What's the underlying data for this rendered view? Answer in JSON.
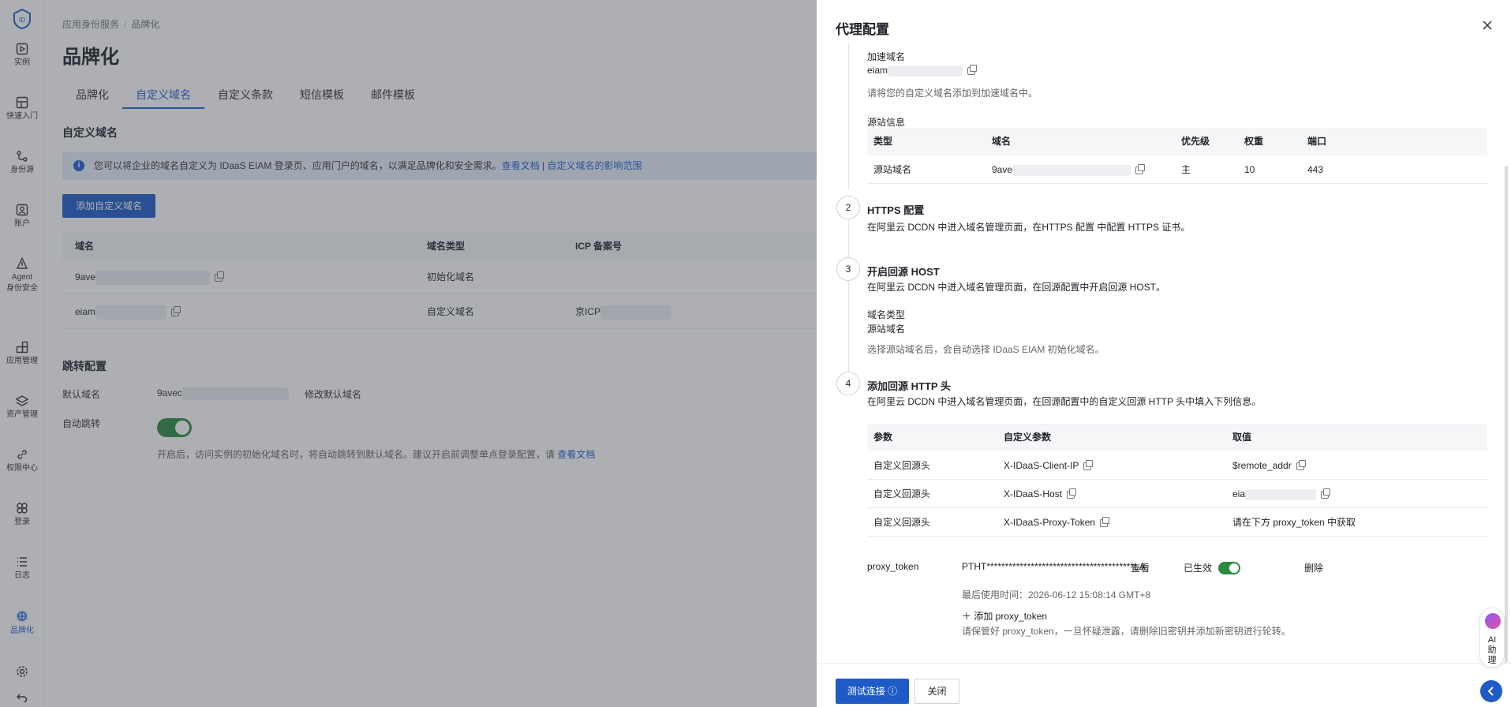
{
  "sidebar": {
    "items": [
      {
        "label": "实例"
      },
      {
        "label": "快速入门"
      },
      {
        "label": "身份源"
      },
      {
        "label": "账户"
      },
      {
        "label": "Agent"
      },
      {
        "label": "身份安全"
      },
      {
        "label": "应用管理"
      },
      {
        "label": "资产管理"
      },
      {
        "label": "权限中心"
      },
      {
        "label": "登录"
      },
      {
        "label": "日志"
      },
      {
        "label": "品牌化"
      }
    ]
  },
  "breadcrumb": {
    "parent": "应用身份服务",
    "sep": "/",
    "current": "品牌化"
  },
  "page_title": "品牌化",
  "tabs": [
    "品牌化",
    "自定义域名",
    "自定义条款",
    "短信模板",
    "邮件模板"
  ],
  "custom_domain": {
    "section_title": "自定义域名",
    "notice_text": "您可以将企业的域名自定义为 IDaaS EIAM 登录页、应用门户的域名，以满足品牌化和安全需求。",
    "notice_link1": "查看文档",
    "notice_sep": " | ",
    "notice_link2": "自定义域名的影响范围",
    "add_button": "添加自定义域名",
    "columns": [
      "域名",
      "域名类型",
      "ICP 备案号"
    ],
    "rows": [
      {
        "domain": "9ave",
        "type": "初始化域名",
        "icp": ""
      },
      {
        "domain": "eiam",
        "type": "自定义域名",
        "icp": "京ICP"
      }
    ]
  },
  "redirect": {
    "section_title": "跳转配置",
    "default_label": "默认域名",
    "default_value": "9avec",
    "modify_link": "修改默认域名",
    "auto_label": "自动跳转",
    "auto_on": true,
    "hint": "开启后，访问实例的初始化域名时，将自动跳转到默认域名。建议开启前调整单点登录配置，请",
    "hint_link": "查看文档"
  },
  "drawer": {
    "title": "代理配置",
    "accel_label": "加速域名",
    "accel_value": "eiam",
    "accel_hint": "请将您的自定义域名添加到加速域名中。",
    "origin_label": "源站信息",
    "origin_columns": [
      "类型",
      "域名",
      "优先级",
      "权重",
      "端口"
    ],
    "origin_rows": [
      {
        "type": "源站域名",
        "domain": "9ave",
        "priority": "主",
        "weight": "10",
        "port": "443"
      }
    ],
    "steps": [
      {
        "num": "2",
        "title": "HTTPS 配置",
        "desc": "在阿里云 DCDN 中进入域名管理页面，在HTTPS 配置 中配置 HTTPS 证书。"
      },
      {
        "num": "3",
        "title": "开启回源 HOST",
        "desc": "在阿里云 DCDN 中进入域名管理页面，在回源配置中开启回源 HOST。"
      },
      {
        "num": "4",
        "title": "添加回源 HTTP 头",
        "desc": "在阿里云 DCDN 中进入域名管理页面，在回源配置中的自定义回源 HTTP 头中填入下列信息。"
      }
    ],
    "host_type_label": "域名类型",
    "host_type_value": "源站域名",
    "host_hint": "选择源站域名后，会自动选择 IDaaS EIAM 初始化域名。",
    "header_columns": [
      "参数",
      "自定义参数",
      "取值"
    ],
    "header_rows": [
      {
        "param": "自定义回源头",
        "custom": "X-IDaaS-Client-IP",
        "value": "$remote_addr"
      },
      {
        "param": "自定义回源头",
        "custom": "X-IDaaS-Host",
        "value": "eia"
      },
      {
        "param": "自定义回源头",
        "custom": "X-IDaaS-Proxy-Token",
        "value": "请在下方 proxy_token 中获取"
      }
    ],
    "token_label": "proxy_token",
    "token_value": "PTHT****************************************LA",
    "token_view": "查看",
    "token_status": "已生效",
    "token_delete": "删除",
    "token_last_used": "最后使用时间：2026-06-12 15:08:14 GMT+8",
    "add_token": "添加 proxy_token",
    "token_warning": "请保管好 proxy_token，一旦怀疑泄露，请删除旧密钥并添加新密钥进行轮转。",
    "test_button": "测试连接",
    "close_button": "关闭"
  },
  "ai_assistant": {
    "label1": "AI",
    "label2": "助",
    "label3": "理"
  },
  "colors": {
    "accent": "#1e5bc6",
    "toggle_on": "#2a8a3e"
  }
}
